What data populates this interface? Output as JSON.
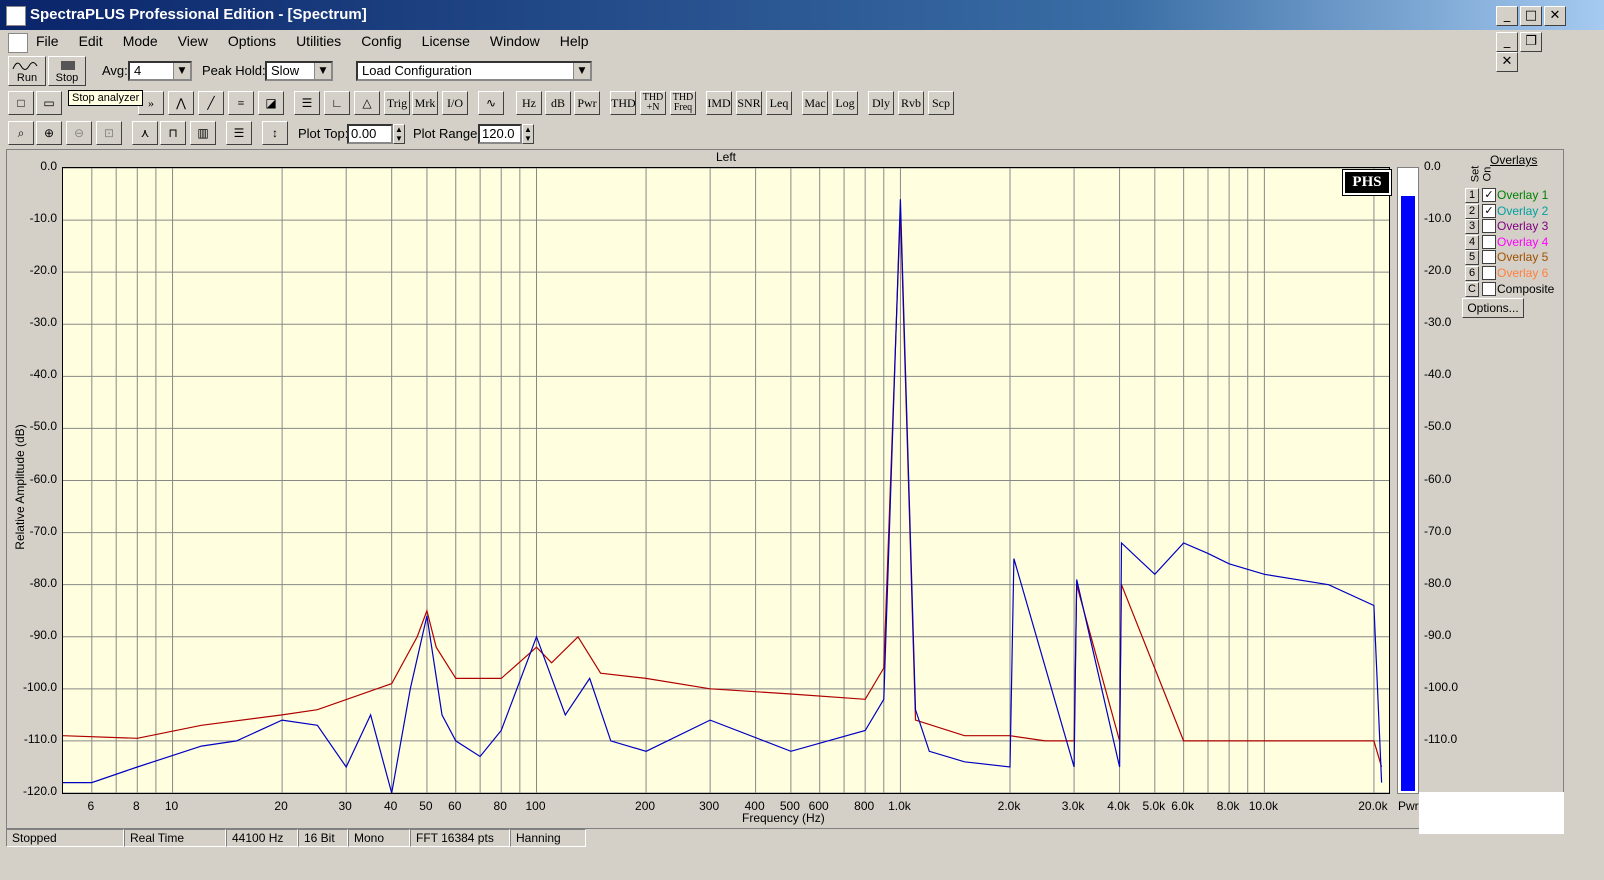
{
  "window": {
    "title": "SpectraPLUS Professional Edition - [Spectrum]",
    "min": "_",
    "max": "□",
    "close": "✕",
    "restore": "❐"
  },
  "menu": [
    "File",
    "Edit",
    "Mode",
    "View",
    "Options",
    "Utilities",
    "Config",
    "License",
    "Window",
    "Help"
  ],
  "toolbar1": {
    "run_label": "Run",
    "stop_label": "Stop",
    "avg_label": "Avg:",
    "avg_value": "4",
    "peak_label": "Peak Hold:",
    "peak_value": "Slow",
    "config_value": "Load Configuration"
  },
  "tooltip": "Stop analyzer",
  "toolbar2": [
    "Trig",
    "Mrk",
    "I/O",
    "Hz",
    "dB",
    "Pwr",
    "THD",
    "THD +N",
    "THD Freq",
    "IMD",
    "SNR",
    "Leq",
    "Mac",
    "Log",
    "Dly",
    "Rvb",
    "Scp"
  ],
  "toolbar3": {
    "plot_top_label": "Plot Top:",
    "plot_top_value": "0.00",
    "plot_range_label": "Plot Range:",
    "plot_range_value": "120.0"
  },
  "chart_data": {
    "type": "line",
    "title": "Left",
    "xlabel": "Frequency (Hz)",
    "ylabel": "Relative Amplitude (dB)",
    "xscale": "log",
    "xlim": [
      5,
      22000
    ],
    "ylim": [
      -120,
      0
    ],
    "x_ticks": [
      6,
      8,
      10,
      20,
      30,
      40,
      50,
      60,
      80,
      100,
      200,
      300,
      400,
      500,
      600,
      800,
      1000,
      2000,
      3000,
      4000,
      5000,
      6000,
      8000,
      10000,
      20000
    ],
    "x_tick_labels": [
      "6",
      "8",
      "10",
      "20",
      "30",
      "40",
      "50",
      "60",
      "80",
      "100",
      "200",
      "300",
      "400",
      "500",
      "600",
      "800",
      "1.0k",
      "2.0k",
      "3.0k",
      "4.0k",
      "5.0k",
      "6.0k",
      "8.0k",
      "10.0k",
      "20.0k"
    ],
    "y_ticks": [
      0,
      -10,
      -20,
      -30,
      -40,
      -50,
      -60,
      -70,
      -80,
      -90,
      -100,
      -110,
      -120
    ],
    "y_tick_labels": [
      "0.0",
      "-10.0",
      "-20.0",
      "-30.0",
      "-40.0",
      "-50.0",
      "-60.0",
      "-70.0",
      "-80.0",
      "-90.0",
      "-100.0",
      "-110.0",
      "-120.0"
    ],
    "grid": true,
    "series": [
      {
        "color": "#b00000",
        "x": [
          5,
          8,
          12,
          20,
          25,
          40,
          47,
          50,
          53,
          60,
          80,
          100,
          110,
          130,
          150,
          200,
          300,
          500,
          800,
          900,
          1000,
          1100,
          1500,
          2000,
          2500,
          3000,
          3050,
          4000,
          4050,
          6000,
          8000,
          10000,
          15000,
          20000,
          21000
        ],
        "y": [
          -109,
          -109.5,
          -107,
          -105,
          -104,
          -99,
          -90,
          -85,
          -92,
          -98,
          -98,
          -92,
          -95,
          -90,
          -97,
          -98,
          -100,
          -101,
          -102,
          -96,
          -8,
          -106,
          -109,
          -109,
          -110,
          -110,
          -80,
          -110,
          -80,
          -110,
          -110,
          -110,
          -110,
          -110,
          -115
        ]
      },
      {
        "color": "#0000c0",
        "x": [
          5,
          6,
          8,
          12,
          15,
          20,
          25,
          30,
          35,
          40,
          45,
          50,
          55,
          60,
          70,
          80,
          100,
          120,
          140,
          160,
          200,
          300,
          500,
          800,
          900,
          1000,
          1100,
          1200,
          1500,
          2000,
          2050,
          3000,
          3050,
          4000,
          4050,
          5000,
          6000,
          7000,
          8000,
          10000,
          15000,
          20000,
          21000
        ],
        "y": [
          -118,
          -118,
          -115,
          -111,
          -110,
          -106,
          -107,
          -115,
          -105,
          -120,
          -100,
          -86,
          -105,
          -110,
          -113,
          -108,
          -90,
          -105,
          -98,
          -110,
          -112,
          -106,
          -112,
          -108,
          -102,
          -6,
          -104,
          -112,
          -114,
          -115,
          -75,
          -115,
          -79,
          -115,
          -72,
          -78,
          -72,
          -74,
          -76,
          -78,
          -80,
          -84,
          -118
        ]
      }
    ]
  },
  "meter": {
    "label": "Pwr",
    "level_db": -5,
    "ticks": [
      "0.0",
      "-10.0",
      "-20.0",
      "-30.0",
      "-40.0",
      "-50.0",
      "-60.0",
      "-70.0",
      "-80.0",
      "-90.0",
      "-100.0",
      "-110.0"
    ]
  },
  "badge": "PHS",
  "overlays": {
    "title": "Overlays",
    "set_label": "Set",
    "on_label": "On",
    "options_label": "Options...",
    "items": [
      {
        "num": "1",
        "name": "Overlay 1",
        "checked": true,
        "color": "#008000"
      },
      {
        "num": "2",
        "name": "Overlay 2",
        "checked": true,
        "color": "#00a0a0"
      },
      {
        "num": "3",
        "name": "Overlay 3",
        "checked": false,
        "color": "#800080"
      },
      {
        "num": "4",
        "name": "Overlay 4",
        "checked": false,
        "color": "#ff00ff"
      },
      {
        "num": "5",
        "name": "Overlay 5",
        "checked": false,
        "color": "#a05000"
      },
      {
        "num": "6",
        "name": "Overlay 6",
        "checked": false,
        "color": "#ff8040"
      },
      {
        "num": "C",
        "name": "Composite",
        "checked": false,
        "color": "#000000"
      }
    ]
  },
  "status": [
    "Stopped",
    "Real Time",
    "44100 Hz",
    "16 Bit",
    "Mono",
    "FFT 16384 pts",
    "Hanning"
  ]
}
